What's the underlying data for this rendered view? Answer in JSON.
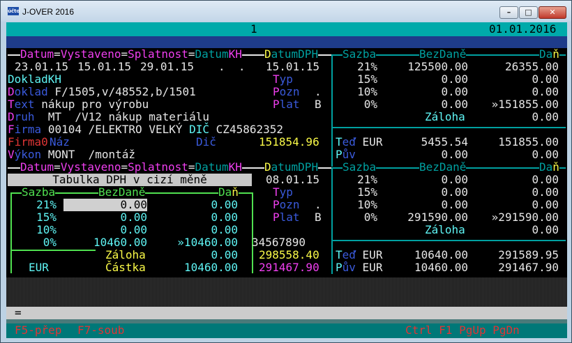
{
  "window": {
    "title": "J-OVER 2016",
    "app_icon_text": "účto"
  },
  "header": {
    "page_number": "1",
    "date": "01.01.2016"
  },
  "upper": {
    "header_labels": {
      "datum": "Datum",
      "vystaveno": "Vystaveno",
      "splatnost": "Splatnost",
      "datum_kh": "Datum",
      "kh": "KH",
      "dph_prefix": "D",
      "datum_dph": "atumDPH",
      "sazba": "Sazba",
      "bez_dane": "BezDaně",
      "dan_prefix": "Da",
      "dan_last": "ň"
    },
    "dates": {
      "datum": "23.01.15",
      "vystaveno": "15.01.15",
      "splatnost": "29.01.15",
      "datum_kh": ".  .",
      "datum_dph": "15.01.15"
    },
    "doklad_kh_label": "DokladKH",
    "doklad": {
      "label_initial": "D",
      "label_rest": "oklad",
      "value": "F/1505,v/48552,b/1501"
    },
    "text": {
      "label_initial": "T",
      "label_rest": "ext",
      "value": "nákup pro výrobu"
    },
    "druh": {
      "label_initial": "D",
      "label_rest": "ruh",
      "code": "MT",
      "value": "/V12 nákup materiálu"
    },
    "firma": {
      "label_initial": "F",
      "label_rest": "irma",
      "code": "00104",
      "name": "/ELEKTRO VELKÝ",
      "dic_label": "DIČ",
      "dic": "CZ45862352"
    },
    "firma0": {
      "label": "Firma0",
      "naz_label": "Náz",
      "dic_label": "Dič",
      "amount": "151854.96"
    },
    "vykon": {
      "label_initial": "V",
      "label_rest": "ýkon",
      "code": "MONT",
      "value": "/montáž"
    },
    "typ": {
      "label_initial": "T",
      "label_rest": "yp"
    },
    "pozn": {
      "label_initial": "P",
      "label_rest": "ozn",
      "value": "."
    },
    "plat": {
      "label_initial": "P",
      "label_rest": "lat",
      "value": "B"
    },
    "rates": [
      {
        "sazba": "21%",
        "bez_dane": "125500.00",
        "dan": "26355.00"
      },
      {
        "sazba": "15%",
        "bez_dane": "0.00",
        "dan": "0.00"
      },
      {
        "sazba": "10%",
        "bez_dane": "0.00",
        "dan": "0.00"
      },
      {
        "sazba": "0%",
        "bez_dane": "0.00",
        "dan": "»151855.00"
      }
    ],
    "zaloha": {
      "label": "Záloha",
      "value": "0.00"
    },
    "ted": {
      "label_initial": "T",
      "label_rest": "eď",
      "currency": "EUR",
      "value1": "5455.54",
      "value2": "151855.00"
    },
    "puv": {
      "label_initial": "P",
      "label_rest": "ův",
      "value1": "0.00",
      "value2": "0.00"
    }
  },
  "lower": {
    "dates": {
      "datum_dph": "08.01.15"
    },
    "currency_table": {
      "title": "Tabulka DPH v cizí měně",
      "headers": {
        "sazba": "Sazba",
        "bez_dane": "BezDaně",
        "dan_prefix": "Da",
        "dan_last": "ň"
      },
      "rows": [
        {
          "sazba": "21%",
          "bez_dane": "0.00",
          "dan": "0.00"
        },
        {
          "sazba": "15%",
          "bez_dane": "0.00",
          "dan": "0.00"
        },
        {
          "sazba": "10%",
          "bez_dane": "0.00",
          "dan": "0.00"
        },
        {
          "sazba": "0%",
          "bez_dane": "10460.00",
          "dan": "»10460.00"
        }
      ],
      "zaloha": {
        "label": "Záloha",
        "value": "0.00"
      },
      "castka": {
        "currency": "EUR",
        "label": "Částka",
        "value": "10460.00"
      }
    },
    "number_field": "34567890",
    "amount_yellow": "298558.40",
    "amount_magenta": "291467.90",
    "rates": [
      {
        "sazba": "21%",
        "bez_dane": "0.00",
        "dan": "0.00"
      },
      {
        "sazba": "15%",
        "bez_dane": "0.00",
        "dan": "0.00"
      },
      {
        "sazba": "10%",
        "bez_dane": "0.00",
        "dan": "0.00"
      },
      {
        "sazba": "0%",
        "bez_dane": "291590.00",
        "dan": "»291590.00"
      }
    ],
    "zaloha": {
      "label": "Záloha",
      "value": "0.00"
    },
    "ted": {
      "label_initial": "T",
      "label_rest": "eď",
      "currency": "EUR",
      "value1": "10640.00",
      "value2": "291589.95"
    },
    "puv": {
      "label_initial": "P",
      "label_rest": "ův",
      "currency": "EUR",
      "value1": "10460.00",
      "value2": "291467.90"
    }
  },
  "command_line": "=",
  "footer": {
    "f5": "F5-přep",
    "f7": "F7-soub",
    "keys": "Ctrl F1 PgUp PgDn"
  }
}
